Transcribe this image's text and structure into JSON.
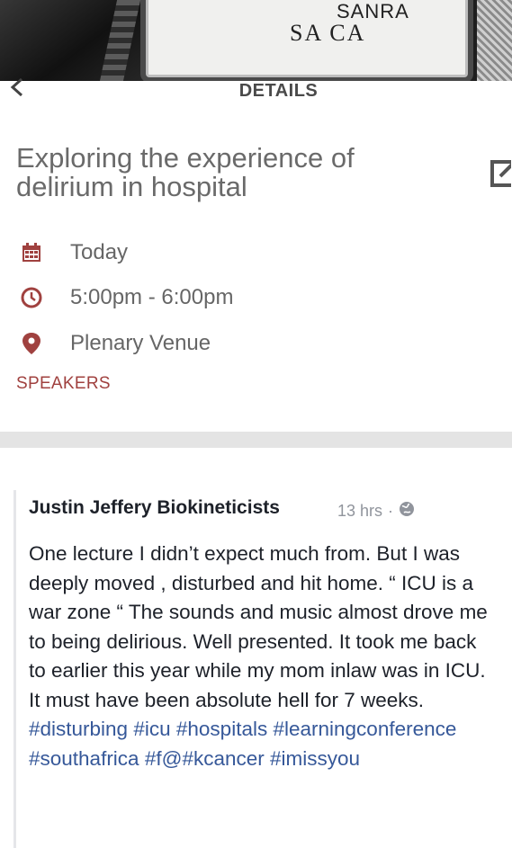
{
  "hero": {
    "badge_line1": "SANRA",
    "badge_line2": "SA CA"
  },
  "nav": {
    "back_icon": "chevron-left-icon",
    "title": "DETAILS"
  },
  "event": {
    "title": "Exploring the experience of delirium in hospital",
    "date": "Today",
    "time": "5:00pm - 6:00pm",
    "venue": "Plenary Venue",
    "speakers_label": "SPEAKERS",
    "accent": "#a0413f"
  },
  "post": {
    "author": "Justin Jeffery Biokineticists",
    "time": "13 hrs",
    "separator": "·",
    "privacy_icon": "globe-icon",
    "text": "One lecture I didn’t expect much from. But I was deeply moved , disturbed and hit home. “ ICU is a war zone “ The sounds and music almost drove me to being delirious. Well presented. It took me back to earlier this year while my mom inlaw was in ICU. It must have been absolute hell for 7 weeks.",
    "hashtags": [
      "#disturbing",
      "#icu",
      "#hospitals",
      "#learningconference",
      "#southafrica",
      "#f@#kcancer",
      "#imissyou"
    ],
    "link_color": "#365899"
  }
}
